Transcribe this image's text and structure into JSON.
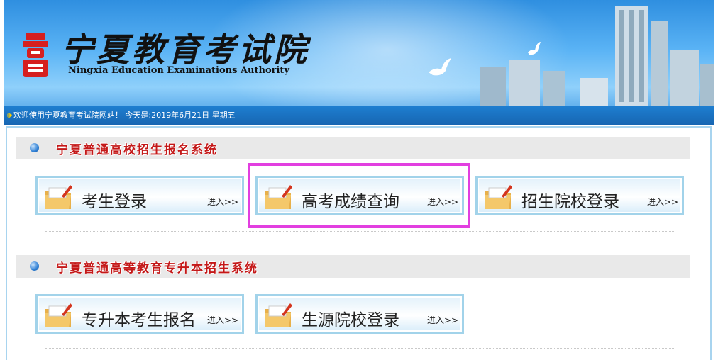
{
  "header": {
    "org_name_cn": "宁夏教育考试院",
    "org_name_en": "Ningxia Education Examinations Authority",
    "emblem_icon": "exam-authority-emblem",
    "welcome_text": "欢迎使用宁夏教育考试院网站！ 今天是:2019年6月21日 星期五"
  },
  "sections": [
    {
      "title": "宁夏普通高校招生报名系统",
      "buttons": [
        {
          "label": "考生登录",
          "enter": "进入>>"
        },
        {
          "label": "高考成绩查询",
          "enter": "进入>>"
        },
        {
          "label": "招生院校登录",
          "enter": "进入>>"
        }
      ]
    },
    {
      "title": "宁夏普通高等教育专升本招生系统",
      "buttons": [
        {
          "label": "专升本考生报名",
          "enter": "进入>>"
        },
        {
          "label": "生源院校登录",
          "enter": "进入>>"
        }
      ]
    }
  ],
  "colors": {
    "accent_highlight": "#e23fe0",
    "section_title": "#c41818",
    "button_border": "#a2d3ea"
  }
}
